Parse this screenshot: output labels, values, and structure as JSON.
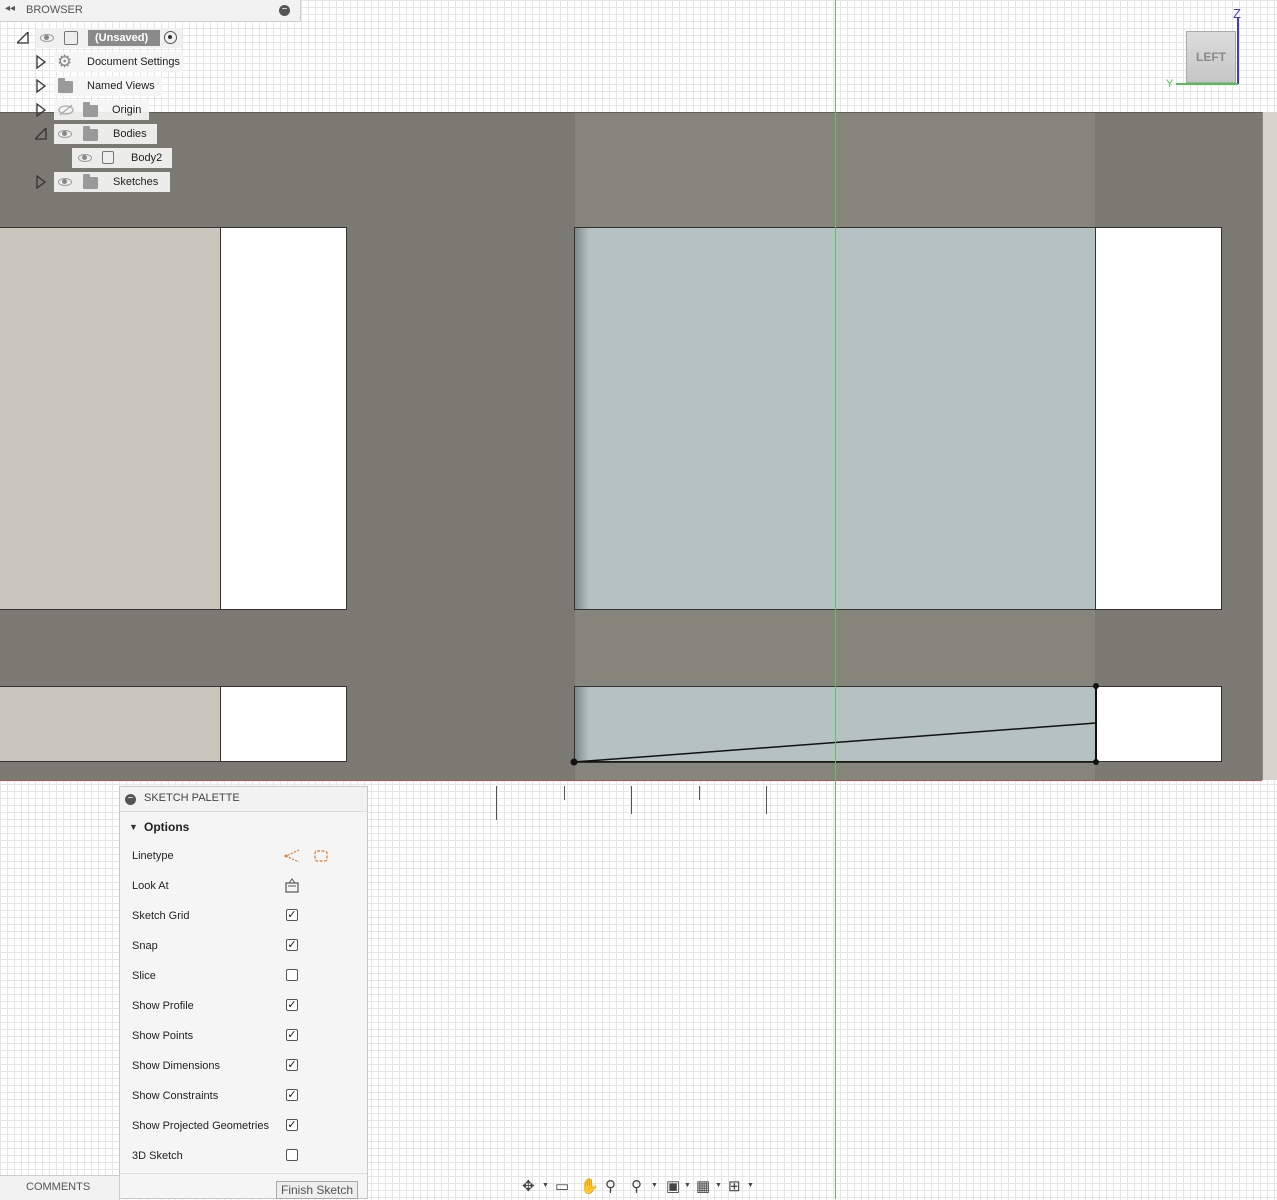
{
  "browser": {
    "title": "BROWSER",
    "collapse_icon": "double-left-arrow",
    "root": {
      "label": "(Unsaved)"
    },
    "items": [
      {
        "label": "Document Settings",
        "icon": "gear-icon"
      },
      {
        "label": "Named Views",
        "icon": "folder-icon"
      },
      {
        "label": "Origin",
        "icon": "folder-icon",
        "visibility": "hidden"
      },
      {
        "label": "Bodies",
        "icon": "folder-icon",
        "expanded": true
      },
      {
        "label": "Body2",
        "icon": "body-icon"
      },
      {
        "label": "Sketches",
        "icon": "folder-icon"
      }
    ]
  },
  "viewcube": {
    "face": "LEFT",
    "z_label": "Z",
    "y_label": "Y"
  },
  "sketch_palette": {
    "title": "SKETCH PALETTE",
    "section": "Options",
    "options": [
      {
        "label": "Linetype",
        "type": "icons"
      },
      {
        "label": "Look At",
        "type": "icon"
      },
      {
        "label": "Sketch Grid",
        "checked": true
      },
      {
        "label": "Snap",
        "checked": true
      },
      {
        "label": "Slice",
        "checked": false
      },
      {
        "label": "Show Profile",
        "checked": true
      },
      {
        "label": "Show Points",
        "checked": true
      },
      {
        "label": "Show Dimensions",
        "checked": true
      },
      {
        "label": "Show Constraints",
        "checked": true
      },
      {
        "label": "Show Projected Geometries",
        "checked": true
      },
      {
        "label": "3D Sketch",
        "checked": false
      }
    ],
    "finish_label": "Finish Sketch"
  },
  "comments": {
    "label": "COMMENTS"
  },
  "colors": {
    "body": "#7b7a72",
    "profile": "#b6c2c1",
    "x_axis": "#c94a4a",
    "y_axis": "#59c459",
    "z_axis": "#3b3bd6"
  },
  "nav_toolbar": [
    "orbit-icon",
    "look-at-icon",
    "pan-icon",
    "zoom-window-icon",
    "fit-icon",
    "display-settings-icon",
    "grid-icon",
    "viewports-icon"
  ]
}
